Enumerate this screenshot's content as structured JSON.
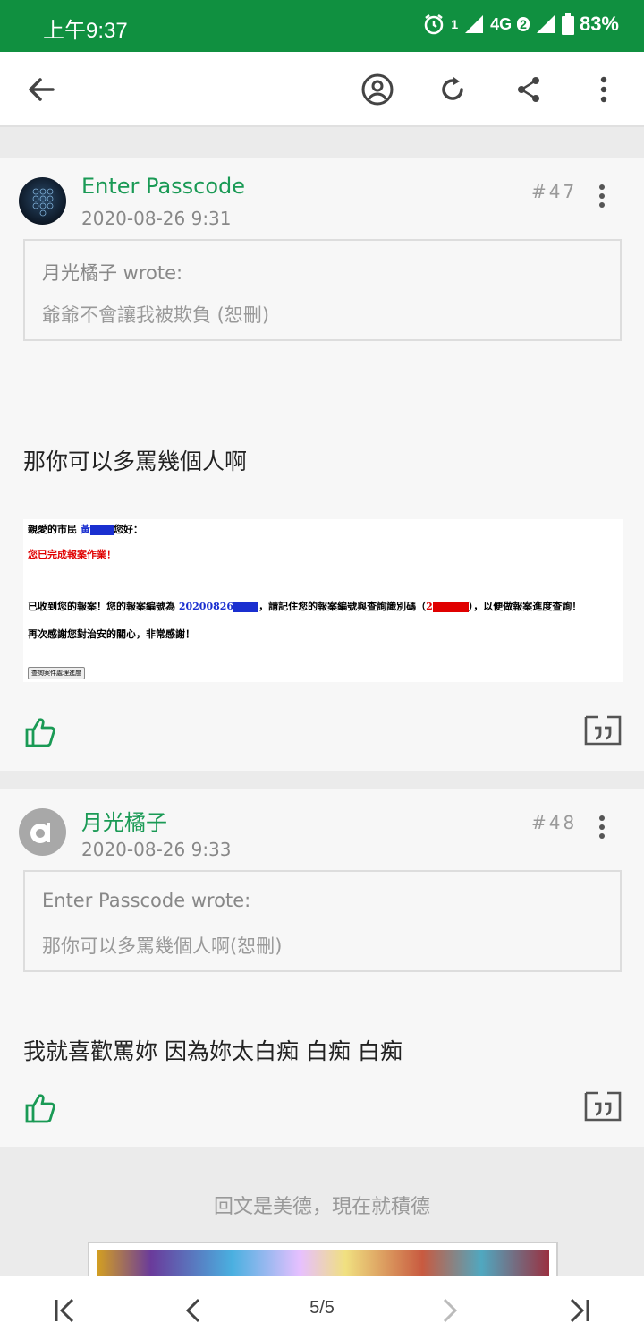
{
  "status_bar": {
    "time": "上午9:37",
    "sim1": "1",
    "network": "4G",
    "sim2": "2",
    "battery": "83%"
  },
  "toolbar": {
    "back_icon": "arrow-left-icon",
    "profile_icon": "user-circle-icon",
    "refresh_icon": "refresh-icon",
    "share_icon": "share-icon",
    "more_icon": "more-vertical-icon"
  },
  "posts": [
    {
      "author": "Enter Passcode",
      "date": "2020-08-26 9:31",
      "floor": "#47",
      "quote_header": "月光橘子 wrote:",
      "quote_text": "爺爺不會讓我被欺負 (恕刪)",
      "body": "那你可以多罵幾個人啊",
      "attachment": {
        "line1_prefix": "親愛的市民",
        "line1_name": "黃",
        "line1_suffix": "您好：",
        "line2": "您已完成報案作業！",
        "line3_prefix": "已收到您的報案！您的報案編號為",
        "line3_number": "20200826",
        "line3_mid": "，請記住您的報案編號與查詢識別碼（",
        "line3_code": "2",
        "line3_suffix": "），以便做報案進度查詢！",
        "line4": "再次感謝您對治安的關心，非常感謝！",
        "button": "查詢案件處理進度"
      }
    },
    {
      "author": "月光橘子",
      "date": "2020-08-26 9:33",
      "floor": "#48",
      "quote_header": "Enter Passcode wrote:",
      "quote_text": "那你可以多罵幾個人啊(恕刪)",
      "body": "我就喜歡罵妳 因為妳太白痴 白痴 白痴"
    }
  ],
  "footer": {
    "prompt": "回文是美德，現在就積德"
  },
  "pagination": {
    "label": "5/5"
  },
  "colors": {
    "status_green": "#109040",
    "author_green": "#1a9a55",
    "like_green": "#1a9a55",
    "redact_blue": "#1a2fd0",
    "redact_red": "#e00000"
  }
}
